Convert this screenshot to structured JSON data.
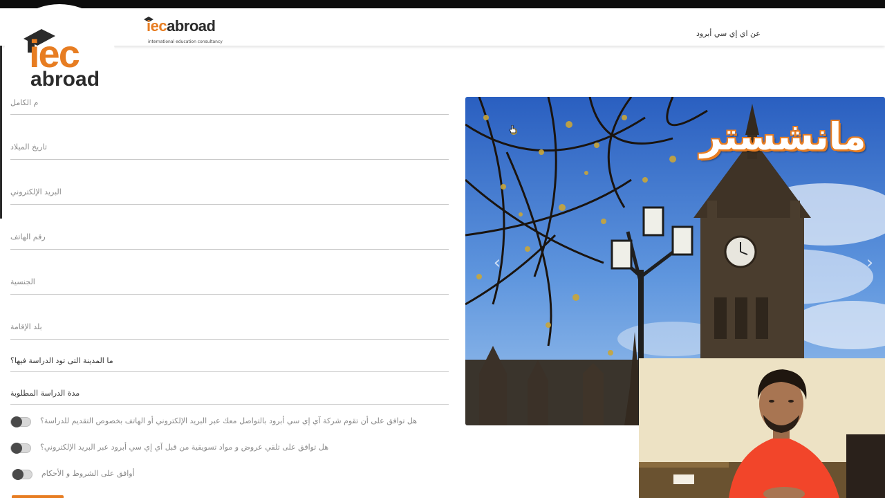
{
  "nav": {
    "logo_iec": "iec",
    "logo_abroad": "abroad",
    "logo_tagline": "international education consultancy",
    "about_link": "عن اي إي سي أبرود"
  },
  "watermark": {
    "iec": "iec",
    "abroad": "abroad"
  },
  "form": {
    "fields": [
      {
        "label": "م الكامل"
      },
      {
        "label": "تاريخ الميلاد"
      },
      {
        "label": "البريد الإلكتروني"
      },
      {
        "label": "رقم الهاتف"
      },
      {
        "label": "الجنسية"
      },
      {
        "label": "بلد الإقامة"
      },
      {
        "label": "ما المدينة التى تود الدراسة فيها؟"
      },
      {
        "label": "مدة الدراسة المطلوبة"
      }
    ],
    "consents": [
      {
        "label": "هل توافق على أن تقوم شركة آي إي سي أبرود بالتواصل معك عبر البريد الإلكتروني أو الهاتف بخصوص التقديم للدراسة؟",
        "checked": false
      },
      {
        "label": "هل توافق على تلقي عروض و مواد تسويقية من قبل آي إي سي أبرود عبر البريد الإلكتروني؟",
        "checked": false
      },
      {
        "label": "أوافق على الشروط و الأحكام",
        "checked": false
      }
    ]
  },
  "slider": {
    "title": "مانشستر",
    "prev_symbol": "‹",
    "next_symbol": "›"
  },
  "colors": {
    "brand_orange": "#e77d22",
    "brand_dark": "#2b2b2b"
  },
  "icons": {
    "cap": "graduation-cap-icon",
    "prev": "chevron-left-icon",
    "next": "chevron-right-icon"
  }
}
